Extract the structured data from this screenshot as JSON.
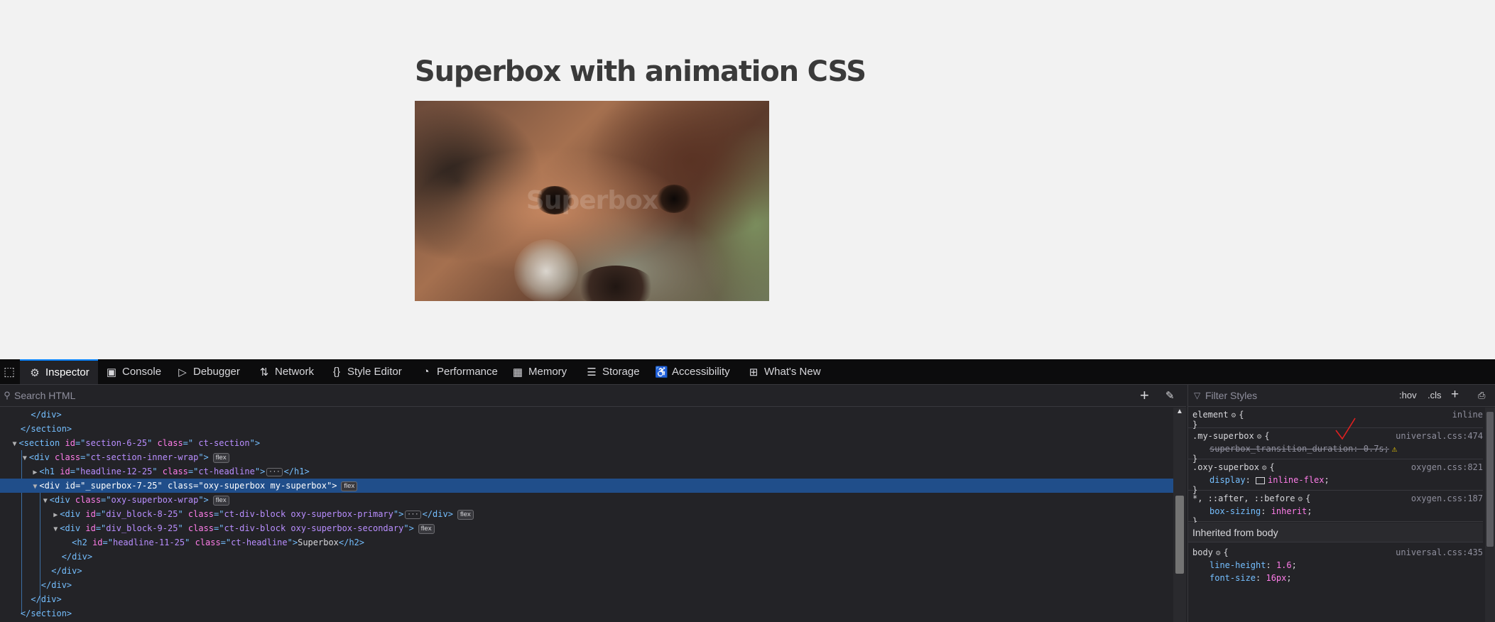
{
  "page": {
    "heading": "Superbox with animation CSS",
    "superbox_secondary_label": "Superbox"
  },
  "devtools": {
    "tabs": [
      {
        "label": "Inspector",
        "icon": "inspector-icon"
      },
      {
        "label": "Console",
        "icon": "console-icon"
      },
      {
        "label": "Debugger",
        "icon": "debugger-icon"
      },
      {
        "label": "Network",
        "icon": "network-icon"
      },
      {
        "label": "Style Editor",
        "icon": "style-editor-icon"
      },
      {
        "label": "Performance",
        "icon": "performance-icon"
      },
      {
        "label": "Memory",
        "icon": "memory-icon"
      },
      {
        "label": "Storage",
        "icon": "storage-icon"
      },
      {
        "label": "Accessibility",
        "icon": "accessibility-icon"
      },
      {
        "label": "What's New",
        "icon": "gift-icon"
      }
    ],
    "html_search_placeholder": "Search HTML",
    "tree": {
      "close_div_1": "</div>",
      "close_section_1": "</section>",
      "section_id": "section-6-25",
      "section_class": " ct-section",
      "inner_wrap_class": "ct-section-inner-wrap",
      "h1_id": "headline-12-25",
      "h1_class": "ct-headline",
      "sb_id": "_superbox-7-25",
      "sb_class": "oxy-superbox my-superbox",
      "wrap_class": "oxy-superbox-wrap",
      "primary_id": "div_block-8-25",
      "primary_class": "ct-div-block oxy-superbox-primary",
      "secondary_id": "div_block-9-25",
      "secondary_class": "ct-div-block oxy-superbox-secondary",
      "h2_id": "headline-11-25",
      "h2_class": "ct-headline",
      "h2_text": "Superbox",
      "badge_flex": "flex"
    },
    "rules": {
      "filter_placeholder": "Filter Styles",
      "hov_label": ":hov",
      "cls_label": ".cls",
      "element": {
        "selector": "element",
        "source": "inline"
      },
      "my_superbox": {
        "selector": ".my-superbox",
        "source": "universal.css:474",
        "prop": "superbox_transition_duration",
        "value": "0.7s"
      },
      "oxy_superbox": {
        "selector": ".oxy-superbox",
        "source": "oxygen.css:821",
        "prop": "display",
        "value": "inline-flex"
      },
      "universal": {
        "selector": "*, ::after, ::before",
        "source": "oxygen.css:187",
        "prop": "box-sizing",
        "value": "inherit"
      },
      "inherited_label": "Inherited from body",
      "body": {
        "selector": "body",
        "source": "universal.css:435",
        "prop1": "line-height",
        "value1": "1.6",
        "prop2": "font-size",
        "value2": "16px"
      }
    }
  }
}
